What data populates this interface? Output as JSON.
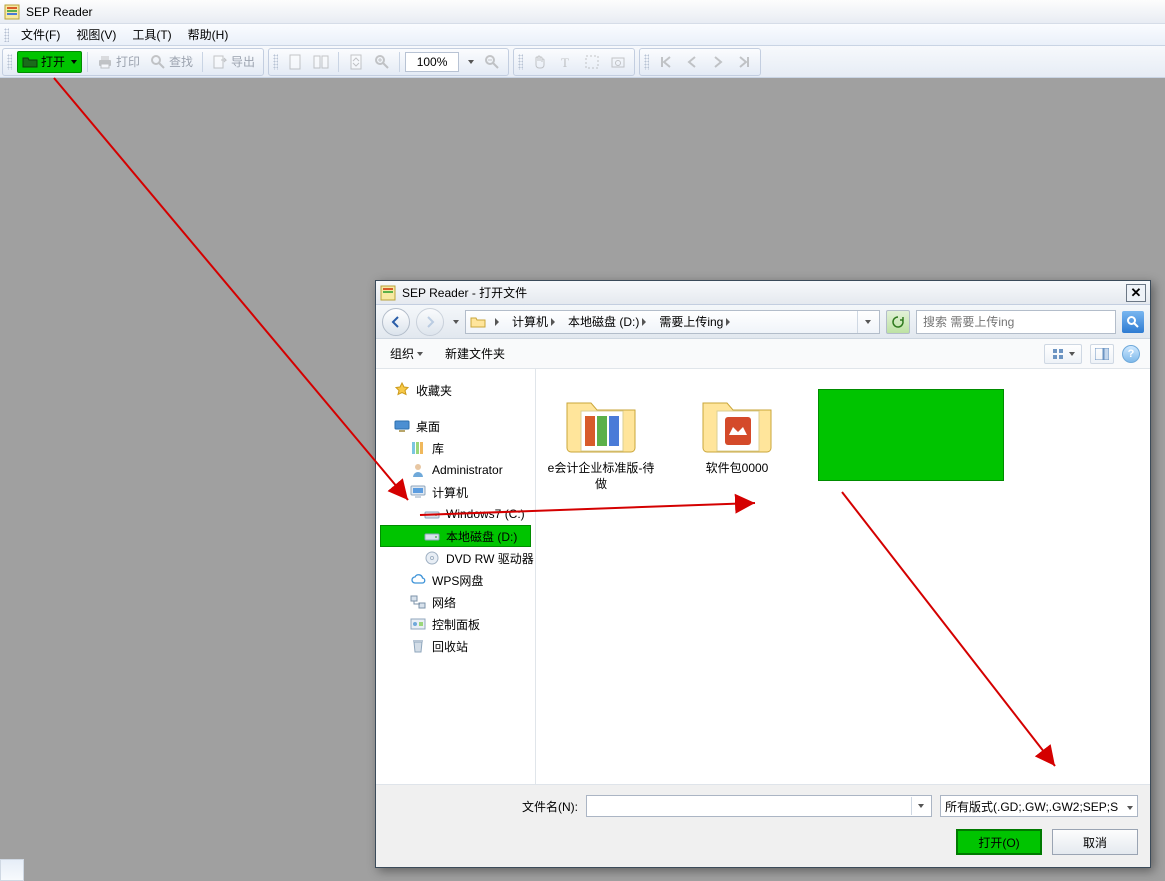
{
  "app": {
    "title": "SEP Reader"
  },
  "menus": {
    "file": "文件(F)",
    "view": "视图(V)",
    "tools": "工具(T)",
    "help": "帮助(H)"
  },
  "toolbar": {
    "open": "打开",
    "print": "打印",
    "find": "查找",
    "export": "导出",
    "zoom": "100%"
  },
  "dialog": {
    "title": "SEP Reader - 打开文件",
    "path": {
      "computer": "计算机",
      "drive": "本地磁盘 (D:)",
      "folder": "需要上传ing"
    },
    "search_placeholder": "搜索 需要上传ing",
    "organize": "组织",
    "newfolder": "新建文件夹",
    "tree": {
      "favorites": "收藏夹",
      "desktop": "桌面",
      "libraries": "库",
      "admin": "Administrator",
      "computer": "计算机",
      "win7": "Windows7 (C:)",
      "dlocal": "本地磁盘 (D:)",
      "dvd": "DVD RW 驱动器 (",
      "wps": "WPS网盘",
      "network": "网络",
      "cpanel": "控制面板",
      "recycle": "回收站"
    },
    "files": {
      "f1": "e会计企业标准版-待做",
      "f2": "软件包0000"
    },
    "footer": {
      "fname_label": "文件名(N):",
      "filter": "所有版式(.GD;.GW;.GW2;SEP;S",
      "open": "打开(O)",
      "cancel": "取消"
    }
  }
}
